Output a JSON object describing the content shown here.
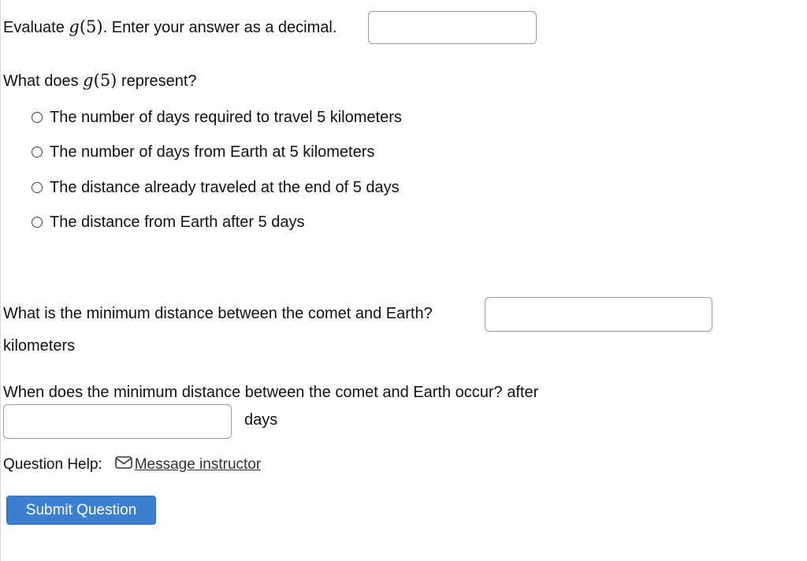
{
  "q1": {
    "prefix": "Evaluate",
    "math_fn": "g",
    "math_arg": "(5)",
    "suffix": ". Enter your answer as a decimal.",
    "answer_value": ""
  },
  "q2": {
    "prefix": "What does",
    "math_fn": "g",
    "math_arg": "(5)",
    "suffix": "represent?",
    "options": [
      "The number of days required to travel 5 kilometers",
      "The number of days from Earth at 5 kilometers",
      "The distance already traveled at the end of 5 days",
      "The distance from Earth after 5 days"
    ]
  },
  "q3": {
    "label": "What is the minimum distance between the comet and Earth?",
    "unit": "kilometers",
    "answer_value": ""
  },
  "q4": {
    "label": "When does the minimum distance between the comet and Earth occur? after",
    "unit": "days",
    "answer_value": ""
  },
  "help": {
    "label": "Question Help:",
    "link_label": "Message instructor",
    "icon": "mail-icon"
  },
  "submit": {
    "label": "Submit Question",
    "color": "#3b7fd0"
  }
}
